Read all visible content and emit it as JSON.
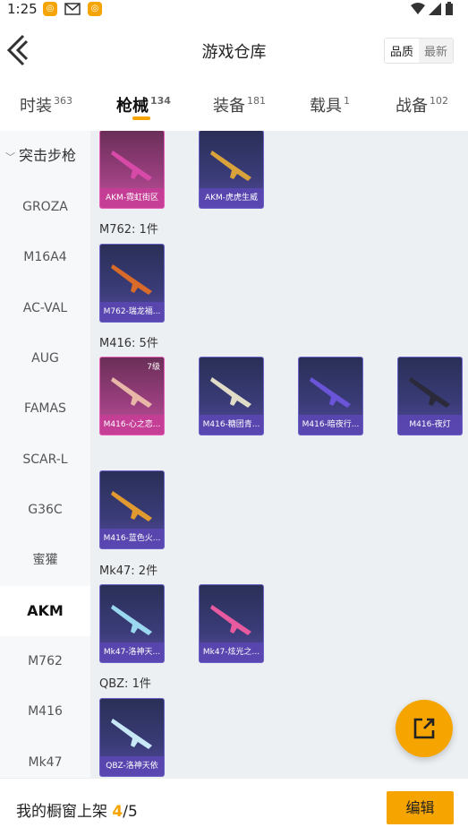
{
  "status_bar": {
    "time": "1:25"
  },
  "header": {
    "title": "游戏仓库",
    "sort_options": [
      "品质",
      "最新"
    ],
    "sort_selected": "品质"
  },
  "tabs": [
    {
      "label": "时装",
      "count": "363"
    },
    {
      "label": "枪械",
      "count": "134",
      "active": true
    },
    {
      "label": "装备",
      "count": "181"
    },
    {
      "label": "载具",
      "count": "1"
    },
    {
      "label": "战备",
      "count": "102"
    }
  ],
  "sidebar": {
    "category": "突击步枪",
    "items": [
      "GROZA",
      "M16A4",
      "AC-VAL",
      "AUG",
      "FAMAS",
      "SCAR-L",
      "G36C",
      "蜜獾",
      "AKM",
      "M762",
      "M416",
      "Mk47"
    ],
    "active": "AKM"
  },
  "sections": [
    {
      "title": "",
      "items": [
        {
          "name": "AKM-霓虹街区"
        },
        {
          "name": "AKM-虎虎生威"
        }
      ]
    },
    {
      "title": "M762: 1件",
      "items": [
        {
          "name": "M762-瑞龙福..."
        }
      ]
    },
    {
      "title": "M416: 5件",
      "items": [
        {
          "name": "M416-心之恋...",
          "level": "7级"
        },
        {
          "name": "M416-糖团青..."
        },
        {
          "name": "M416-暗夜行..."
        },
        {
          "name": "M416-夜灯"
        },
        {
          "name": "M416-蓝色火..."
        }
      ]
    },
    {
      "title": "Mk47: 2件",
      "items": [
        {
          "name": "Mk47-洛神天..."
        },
        {
          "name": "Mk47-炫光之..."
        }
      ]
    },
    {
      "title": "QBZ: 1件",
      "items": [
        {
          "name": "QBZ-洛神天依"
        }
      ]
    }
  ],
  "bottom_bar": {
    "label": "我的橱窗上架",
    "current": "4",
    "separator": "/",
    "total": "5",
    "edit_label": "编辑"
  },
  "colors": {
    "accent": "#f5a400",
    "sidebar_bg": "#f7f8fa",
    "content_bg": "#edf0f3"
  }
}
